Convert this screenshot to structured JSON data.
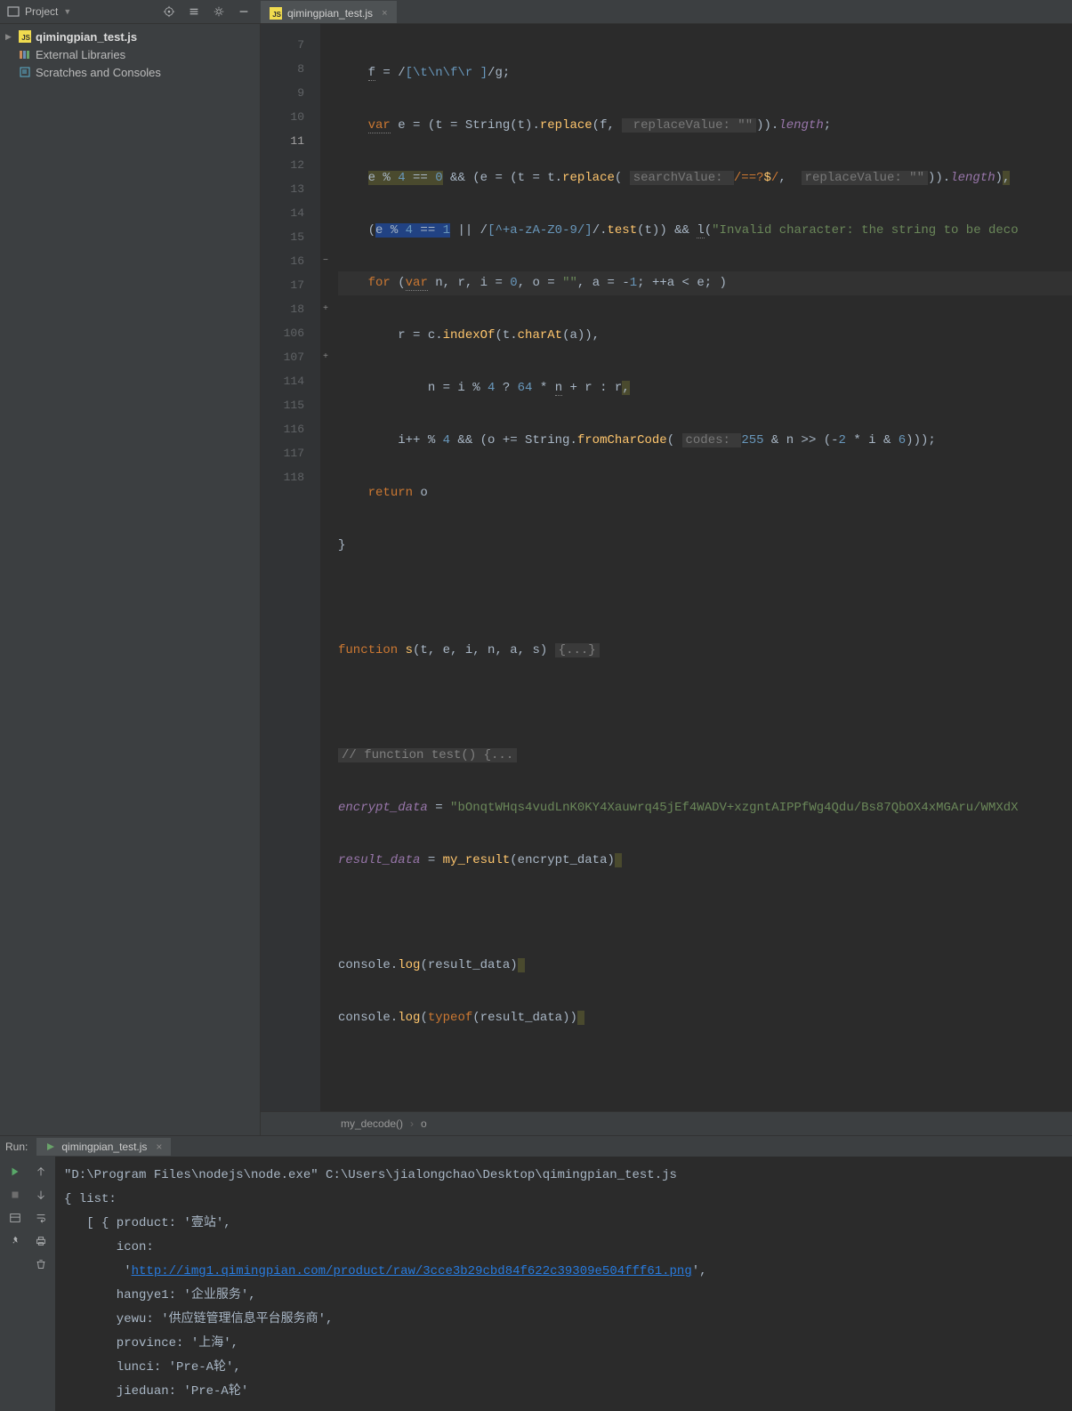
{
  "project_label": "Project",
  "editor_tab": "qimingpian_test.js",
  "sidebar": {
    "items": [
      {
        "label": "qimingpian_test.js",
        "kind": "js",
        "expandable": true
      },
      {
        "label": "External Libraries",
        "kind": "lib",
        "expandable": false
      },
      {
        "label": "Scratches and Consoles",
        "kind": "scratch",
        "expandable": false
      }
    ]
  },
  "gutter": [
    "7",
    "8",
    "9",
    "10",
    "11",
    "12",
    "13",
    "14",
    "15",
    "16",
    "17",
    "18",
    "106",
    "107",
    "114",
    "115",
    "116",
    "117",
    "118"
  ],
  "caret_line_index": 4,
  "folds": {
    "9": "−",
    "11": "+",
    "13": "+"
  },
  "code": {
    "l7": {
      "pre": "    ",
      "var": "f",
      "eq": " = /",
      "rgx": "[\\t\\n\\f\\r ]",
      "post": "/g;"
    },
    "l8": {
      "pre": "    ",
      "kw": "var",
      "mid1": " e = (t = String(t).",
      "fn": "replace",
      "mid2": "(f, ",
      "hint": " replaceValue: \"\"",
      "mid3": ")).",
      "prop": "length",
      "end": ";"
    },
    "l9": {
      "pre": "    ",
      "h1": "e % ",
      "n4": "4",
      "heq": " == ",
      "n0": "0",
      "mid1": " && (e = (t = t.",
      "fn": "replace",
      "mid2": "( ",
      "hint1": "searchValue: ",
      "rg": "/==?",
      "rgd": "$",
      "rge": "/",
      "mid3": ",  ",
      "hint2": "replaceValue: \"\"",
      "mid4": ")).",
      "prop": "length",
      "mid5": ")",
      ",": ","
    },
    "l10": {
      "pre": "    (",
      "h": "e % ",
      "n4": "4",
      "eq": " == ",
      "n1": "1",
      "mid1": " || /",
      "rgx": "[^+a-zA-Z0-9/]",
      "mid2": "/.",
      "fn": "test",
      "mid3": "(t)) && ",
      "l": "l",
      "mid4": "(",
      "str": "\"Invalid character: the string to be deco"
    },
    "l11": {
      "pre": "    ",
      "for": "for",
      "mid1": " (",
      "var": "var",
      "mid2": " n, r, i = ",
      "n0": "0",
      "mid3": ", o = ",
      "str": "\"\"",
      "mid4": ", a = -",
      "n1": "1",
      "mid5": "; ++a < e; )"
    },
    "l12": {
      "pre": "        r = c.",
      "fn1": "indexOf",
      "mid": "(t.",
      "fn2": "charAt",
      "end": "(a)),"
    },
    "l13": {
      "pre": "            n = i % ",
      "n4": "4",
      "q": " ? ",
      "n64": "64",
      "mid": " * ",
      "u": "n",
      "end": " + r : r",
      ",": ","
    },
    "l14": {
      "pre": "        i++ % ",
      "n4": "4",
      "mid1": " && (o += String.",
      "fn": "fromCharCode",
      "mid2": "( ",
      "hint": "codes: ",
      "n255": "255",
      "mid3": " & n >> (-",
      "n2": "2",
      "mid4": " * i & ",
      "n6": "6",
      "mid5": ")));"
    },
    "l15": {
      "pre": "    ",
      "ret": "return",
      "end": " o"
    },
    "l16": {
      "t": "}"
    },
    "l18": {
      "kw": "function",
      "sp": " ",
      "fn": "s",
      "args": "(t, e, i, n, a, s) ",
      "fold": "{...}"
    },
    "l107": {
      "t": "// function test() {..."
    },
    "l114": {
      "v": "encrypt_data",
      "eq": " = ",
      "str": "\"bOnqtWHqs4vudLnK0KY4Xauwrq45jEf4WADV+xzgntAIPPfWg4Qdu/Bs87QbOX4xMGAru/WMXdX"
    },
    "l115": {
      "v": "result_data",
      "eq": " = ",
      "fn": "my_result",
      "args": "(encrypt_data)"
    },
    "l117": {
      "o": "console.",
      "fn": "log",
      "args": "(result_data)"
    },
    "l118": {
      "o": "console.",
      "fn": "log",
      "mid": "(",
      "tof": "typeof",
      "end": "(result_data))"
    }
  },
  "breadcrumb": {
    "a": "my_decode()",
    "b": "o"
  },
  "run": {
    "label": "Run:",
    "tab": "qimingpian_test.js",
    "cmd": "\"D:\\Program Files\\nodejs\\node.exe\" C:\\Users\\jialongchao\\Desktop\\qimingpian_test.js",
    "out1": "{ list:",
    "out2": "   [ { product: '壹站',",
    "out3": "       icon:",
    "out4a": "        '",
    "url": "http://img1.qimingpian.com/product/raw/3cce3b29cbd84f622c39309e504fff61.png",
    "out4b": "',",
    "out5": "       hangye1: '企业服务',",
    "out6": "       yewu: '供应链管理信息平台服务商',",
    "out7": "       province: '上海',",
    "out8": "       lunci: 'Pre-A轮',",
    "out9": "       jieduan: 'Pre-A轮'"
  }
}
